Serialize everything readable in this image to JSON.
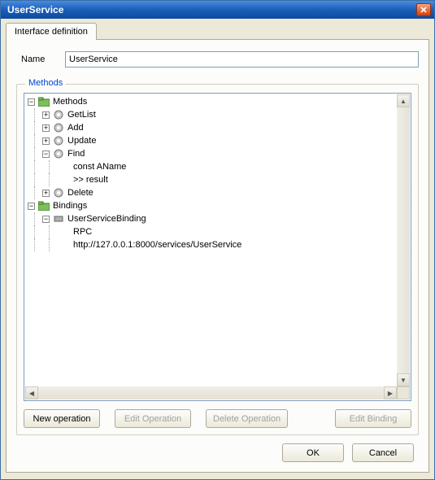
{
  "title": "UserService",
  "tab": {
    "label": "Interface definition"
  },
  "name": {
    "label": "Name",
    "value": "UserService"
  },
  "methods_group": {
    "label": "Methods"
  },
  "tree": {
    "methods": {
      "label": "Methods",
      "items": {
        "getlist": "GetList",
        "add": "Add",
        "update": "Update",
        "find": {
          "label": "Find",
          "children": {
            "c1": "const  AName",
            "c2": ">> result"
          }
        },
        "delete": "Delete"
      }
    },
    "bindings": {
      "label": "Bindings",
      "items": {
        "userservicebinding": {
          "label": "UserServiceBinding",
          "children": {
            "c1": "RPC",
            "c2": "http://127.0.0.1:8000/services/UserService"
          }
        }
      }
    }
  },
  "buttons": {
    "new_operation": "New operation",
    "edit_operation": "Edit Operation",
    "delete_operation": "Delete Operation",
    "edit_binding": "Edit Binding",
    "ok": "OK",
    "cancel": "Cancel"
  }
}
